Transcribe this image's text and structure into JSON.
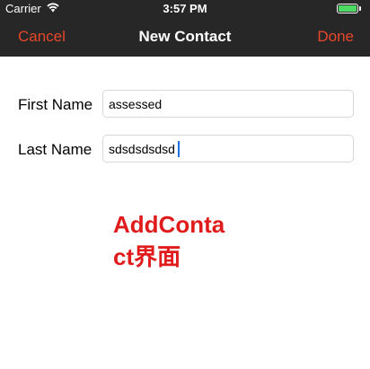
{
  "status_bar": {
    "carrier": "Carrier",
    "time": "3:57 PM",
    "battery_color": "#4cd964",
    "wifi_icon": "wifi-icon",
    "battery_icon": "battery-icon"
  },
  "navigation": {
    "cancel_label": "Cancel",
    "title": "New Contact",
    "done_label": "Done",
    "accent_color": "#e8472b",
    "bar_color": "#272727"
  },
  "form": {
    "first_name": {
      "label": "First Name",
      "value": "assessed"
    },
    "last_name": {
      "label": "Last Name",
      "value": "sdsdsdsdsd"
    }
  },
  "overlay": {
    "caption_line1": "AddConta",
    "caption_line2": "ct界面",
    "color": "#e01b1b"
  }
}
